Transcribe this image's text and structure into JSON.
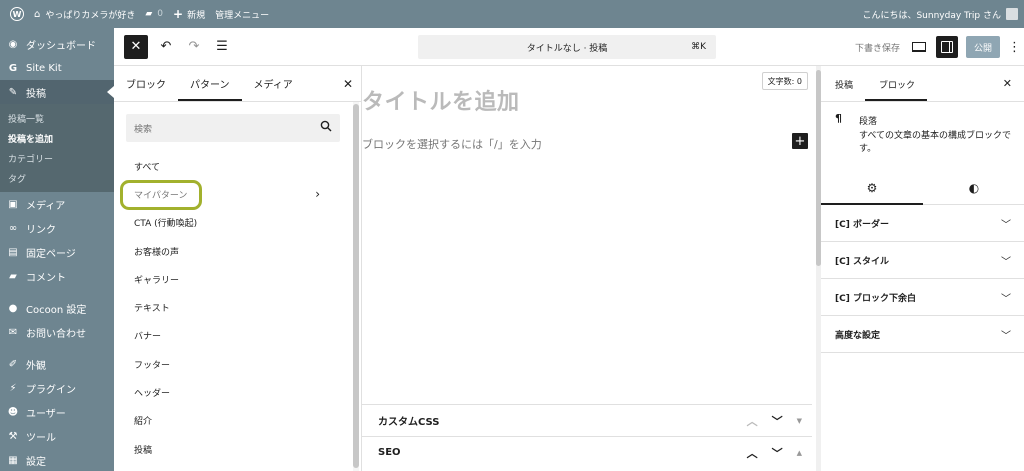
{
  "adminbar": {
    "site_name": "やっぱりカメラが好き",
    "comments_count": "0",
    "new_label": "新規",
    "admin_menu_label": "管理メニュー",
    "greeting": "こんにちは、Sunnyday Trip さん"
  },
  "sidebar": {
    "items": [
      {
        "icon": "dashboard-icon",
        "label": "ダッシュボード"
      },
      {
        "icon": "sitekit-icon",
        "label": "Site Kit"
      },
      {
        "icon": "pin-icon",
        "label": "投稿"
      },
      {
        "icon": "media-icon",
        "label": "メディア"
      },
      {
        "icon": "link-icon",
        "label": "リンク"
      },
      {
        "icon": "page-icon",
        "label": "固定ページ"
      },
      {
        "icon": "comment-icon",
        "label": "コメント"
      },
      {
        "icon": "cocoon-icon",
        "label": "Cocoon 設定"
      },
      {
        "icon": "mail-icon",
        "label": "お問い合わせ"
      },
      {
        "icon": "brush-icon",
        "label": "外観"
      },
      {
        "icon": "plugin-icon",
        "label": "プラグイン"
      },
      {
        "icon": "user-icon",
        "label": "ユーザー"
      },
      {
        "icon": "tool-icon",
        "label": "ツール"
      },
      {
        "icon": "settings-icon",
        "label": "設定"
      }
    ],
    "submenu": [
      "投稿一覧",
      "投稿を追加",
      "カテゴリー",
      "タグ"
    ]
  },
  "toolbar": {
    "command_bar": "タイトルなし · 投稿",
    "shortcut": "⌘K",
    "save_draft": "下書き保存",
    "publish": "公開"
  },
  "inserter": {
    "tabs": [
      "ブロック",
      "パターン",
      "メディア"
    ],
    "search_placeholder": "検索",
    "categories": [
      "すべて",
      "マイパターン",
      "CTA (行動喚起)",
      "お客様の声",
      "ギャラリー",
      "テキスト",
      "バナー",
      "フッター",
      "ヘッダー",
      "紹介",
      "投稿"
    ]
  },
  "canvas": {
    "word_count": "文字数: 0",
    "title_placeholder": "タイトルを追加",
    "block_placeholder": "ブロックを選択するには「/」を入力",
    "meta_boxes": [
      "カスタムCSS",
      "SEO"
    ]
  },
  "settings": {
    "tabs": [
      "投稿",
      "ブロック"
    ],
    "block_name": "段落",
    "block_desc": "すべての文章の基本の構成ブロックです。",
    "panels": [
      "[C] ボーダー",
      "[C] スタイル",
      "[C] ブロック下余白",
      "高度な設定"
    ]
  },
  "colors": {
    "sidebar_bg": "#6e8590",
    "highlight_ring": "#a2b12d",
    "publish_bg": "#8fa6b3"
  }
}
